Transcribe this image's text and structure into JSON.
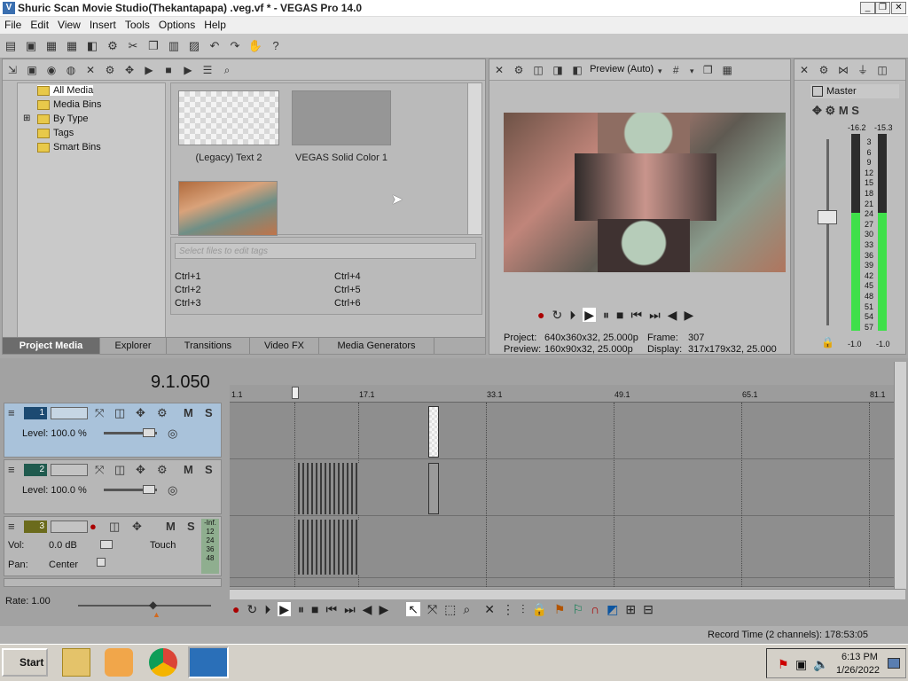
{
  "title": "Shuric Scan Movie Studio(Thekantapapa) .veg.vf * - VEGAS Pro 14.0",
  "menu": [
    "File",
    "Edit",
    "View",
    "Insert",
    "Tools",
    "Options",
    "Help"
  ],
  "media_tree": [
    "All Media",
    "Media Bins",
    "By Type",
    "Tags",
    "Smart Bins"
  ],
  "media_items": {
    "item1": "(Legacy) Text 2",
    "item2": "VEGAS Solid Color 1"
  },
  "tags": {
    "placeholder": "Select files to edit tags",
    "shortcuts": [
      "Ctrl+1",
      "Ctrl+2",
      "Ctrl+3",
      "Ctrl+4",
      "Ctrl+5",
      "Ctrl+6"
    ]
  },
  "tabs": [
    "Project Media",
    "Explorer",
    "Transitions",
    "Video FX",
    "Media Generators"
  ],
  "preview": {
    "mode": "Preview (Auto)",
    "project_label": "Project:",
    "project_value": "640x360x32, 25.000p",
    "preview_label": "Preview:",
    "preview_value": "160x90x32, 25.000p",
    "frame_label": "Frame:",
    "frame_value": "307",
    "display_label": "Display:",
    "display_value": "317x179x32, 25.000"
  },
  "master": {
    "title": "Master",
    "left_peak": "-16.2",
    "right_peak": "-15.3",
    "scale": [
      "3",
      "6",
      "9",
      "12",
      "15",
      "18",
      "21",
      "24",
      "27",
      "30",
      "33",
      "36",
      "39",
      "42",
      "45",
      "48",
      "51",
      "54",
      "57"
    ],
    "bottom_left": "-1.0",
    "bottom_right": "-1.0",
    "left_level": 0.6,
    "right_level": 0.6
  },
  "timeline": {
    "position": "9.1.050",
    "ruler": [
      "1.1",
      "17.1",
      "33.1",
      "49.1",
      "65.1",
      "81.1"
    ],
    "tracks": [
      {
        "num": "1",
        "level": "Level: 100.0 %"
      },
      {
        "num": "2",
        "level": "Level: 100.0 %"
      }
    ],
    "audio": {
      "num": "3",
      "vol_label": "Vol:",
      "vol_value": "0.0 dB",
      "pan_label": "Pan:",
      "pan_value": "Center",
      "mode": "Touch",
      "meter_top": "-Inf.",
      "meter_scale": [
        "12",
        "24",
        "36",
        "48"
      ]
    },
    "rate": "Rate: 1.00"
  },
  "status": "Record Time (2 channels): 178:53:05",
  "taskbar": {
    "start": "Start",
    "time": "6:13 PM",
    "date": "1/26/2022"
  }
}
